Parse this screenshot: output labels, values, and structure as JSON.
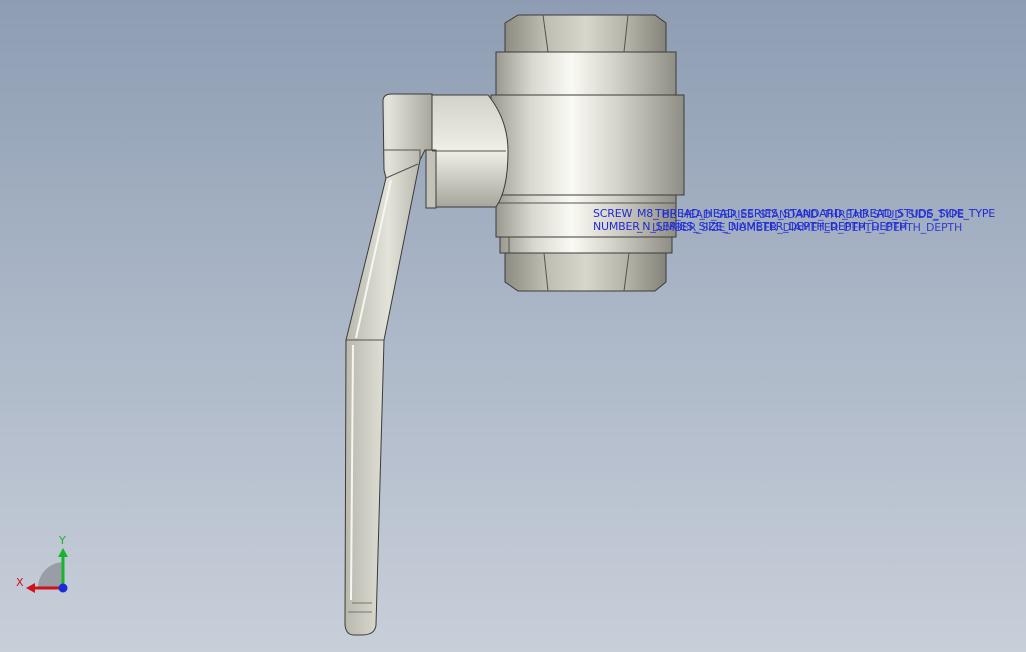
{
  "annotations": {
    "row1": [
      "SCREW",
      "M8_",
      "THREAD_HEAD_SERIES_STANDARD_THREAD_STUDS_SIDE_TYPE",
      "BL_HEAD_SERIES_STANDARD_THREAD_STUD_SIDE_TYPE"
    ],
    "row2": [
      "NUMBER",
      "_N_SERIES_SIZE_DIAMETER_DEPTH_DEPTH_DEPTH",
      "LUMBER_SIZE_NUMBER_DIAMETER_DEPTH_DEPTH_DEPTH"
    ]
  },
  "triad": {
    "x_label": "X",
    "y_label": "Y",
    "x_color": "#d0121b",
    "y_color": "#19b42a",
    "z_color": "#1b2bd8"
  },
  "model": {
    "name": "clamping-lever-with-hex-nut",
    "colors": {
      "metal_light": "#f1f1ea",
      "metal_mid": "#c9c8bd",
      "metal_dark": "#8e8d83",
      "edge": "#3b3b36"
    }
  }
}
